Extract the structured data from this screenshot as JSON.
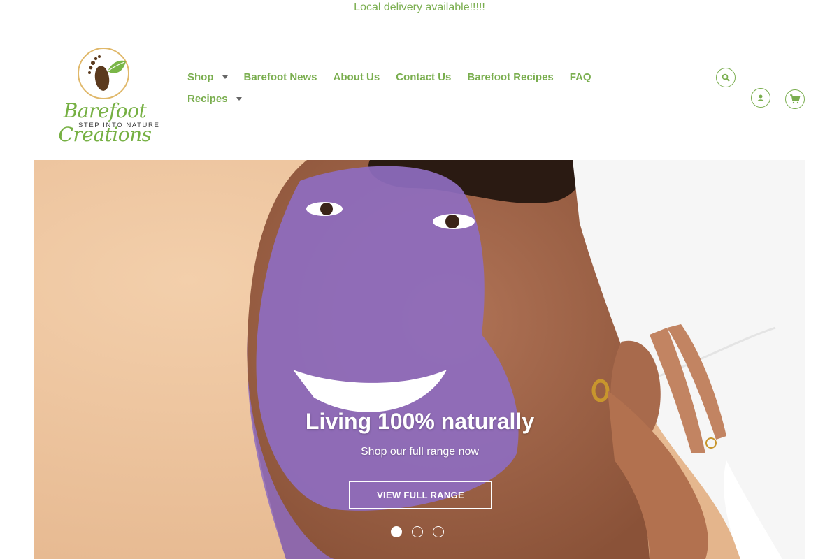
{
  "announcement": "Local delivery available!!!!!",
  "logo": {
    "brand": "Barefoot Creations",
    "tagline": "STEP INTO NATURE"
  },
  "nav": {
    "row1": [
      {
        "label": "Shop",
        "dropdown": true
      },
      {
        "label": "Barefoot News",
        "dropdown": false
      },
      {
        "label": "About Us",
        "dropdown": false
      },
      {
        "label": "Contact Us",
        "dropdown": false
      },
      {
        "label": "Barefoot Recipes",
        "dropdown": false
      },
      {
        "label": "FAQ",
        "dropdown": false
      }
    ],
    "row2": [
      {
        "label": "Recipes",
        "dropdown": true
      }
    ]
  },
  "header_icons": [
    "search-icon",
    "account-icon",
    "cart-icon"
  ],
  "hero": {
    "title": "Living 100% naturally",
    "subtitle": "Shop our full range now",
    "button": "VIEW FULL RANGE",
    "slide_count": 3,
    "active_slide": 1
  },
  "colors": {
    "accent": "#7aae4f",
    "hero_background": "#ecc29e",
    "scrub": "#8e6cc0"
  }
}
